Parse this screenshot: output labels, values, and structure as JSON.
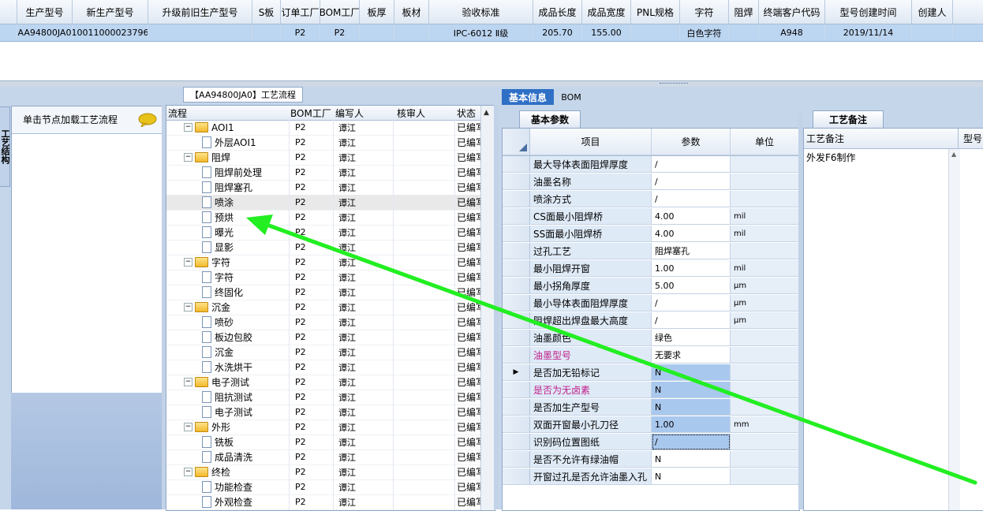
{
  "top_grid": {
    "columns": [
      "生产型号",
      "新生产型号",
      "升级前旧生产型号",
      "S板",
      "订单工厂",
      "BOM工厂",
      "板厚",
      "板材",
      "验收标准",
      "成品长度",
      "成品宽度",
      "PNL规格",
      "字符",
      "阻焊",
      "终端客户代码",
      "型号创建时间",
      "创建人"
    ],
    "row": [
      "AA94800JA0",
      "10011000023796",
      "",
      "",
      "P2",
      "P2",
      "",
      "",
      "IPC-6012 Ⅱ级",
      "205.70",
      "155.00",
      "",
      "白色字符",
      "",
      "A948",
      "2019/11/14",
      ""
    ]
  },
  "left_panel": {
    "side_tab": "工艺结构",
    "node_hint": "单击节点加载工艺流程",
    "tree_title": "【AA94800JA0】工艺流程",
    "tree_columns": [
      "流程",
      "BOM工厂",
      "编写人",
      "核审人",
      "状态"
    ],
    "tree_rows": [
      {
        "name": "AOI1",
        "type": "folder",
        "level": 0,
        "bom": "P2",
        "author": "谭江",
        "reviewer": "",
        "status": "已编写"
      },
      {
        "name": "外层AOI1",
        "type": "doc",
        "level": 1,
        "bom": "P2",
        "author": "谭江",
        "reviewer": "",
        "status": "已编写"
      },
      {
        "name": "阻焊",
        "type": "folder",
        "level": 0,
        "bom": "P2",
        "author": "谭江",
        "reviewer": "",
        "status": "已编写"
      },
      {
        "name": "阻焊前处理",
        "type": "doc",
        "level": 1,
        "bom": "P2",
        "author": "谭江",
        "reviewer": "",
        "status": "已编写"
      },
      {
        "name": "阻焊塞孔",
        "type": "doc",
        "level": 1,
        "bom": "P2",
        "author": "谭江",
        "reviewer": "",
        "status": "已编写"
      },
      {
        "name": "喷涂",
        "type": "doc",
        "level": 1,
        "bom": "P2",
        "author": "谭江",
        "reviewer": "",
        "status": "已编写",
        "selected": true
      },
      {
        "name": "预烘",
        "type": "doc",
        "level": 1,
        "bom": "P2",
        "author": "谭江",
        "reviewer": "",
        "status": "已编写"
      },
      {
        "name": "曝光",
        "type": "doc",
        "level": 1,
        "bom": "P2",
        "author": "谭江",
        "reviewer": "",
        "status": "已编写"
      },
      {
        "name": "显影",
        "type": "doc",
        "level": 1,
        "bom": "P2",
        "author": "谭江",
        "reviewer": "",
        "status": "已编写"
      },
      {
        "name": "字符",
        "type": "folder",
        "level": 0,
        "bom": "P2",
        "author": "谭江",
        "reviewer": "",
        "status": "已编写"
      },
      {
        "name": "字符",
        "type": "doc",
        "level": 1,
        "bom": "P2",
        "author": "谭江",
        "reviewer": "",
        "status": "已编写"
      },
      {
        "name": "终固化",
        "type": "doc",
        "level": 1,
        "bom": "P2",
        "author": "谭江",
        "reviewer": "",
        "status": "已编写"
      },
      {
        "name": "沉金",
        "type": "folder",
        "level": 0,
        "bom": "P2",
        "author": "谭江",
        "reviewer": "",
        "status": "已编写"
      },
      {
        "name": "喷砂",
        "type": "doc",
        "level": 1,
        "bom": "P2",
        "author": "谭江",
        "reviewer": "",
        "status": "已编写"
      },
      {
        "name": "板边包胶",
        "type": "doc",
        "level": 1,
        "bom": "P2",
        "author": "谭江",
        "reviewer": "",
        "status": "已编写"
      },
      {
        "name": "沉金",
        "type": "doc",
        "level": 1,
        "bom": "P2",
        "author": "谭江",
        "reviewer": "",
        "status": "已编写"
      },
      {
        "name": "水洗烘干",
        "type": "doc",
        "level": 1,
        "bom": "P2",
        "author": "谭江",
        "reviewer": "",
        "status": "已编写"
      },
      {
        "name": "电子测试",
        "type": "folder",
        "level": 0,
        "bom": "P2",
        "author": "谭江",
        "reviewer": "",
        "status": "已编写"
      },
      {
        "name": "阻抗测试",
        "type": "doc",
        "level": 1,
        "bom": "P2",
        "author": "谭江",
        "reviewer": "",
        "status": "已编写"
      },
      {
        "name": "电子测试",
        "type": "doc",
        "level": 1,
        "bom": "P2",
        "author": "谭江",
        "reviewer": "",
        "status": "已编写"
      },
      {
        "name": "外形",
        "type": "folder",
        "level": 0,
        "bom": "P2",
        "author": "谭江",
        "reviewer": "",
        "status": "已编写"
      },
      {
        "name": "铣板",
        "type": "doc",
        "level": 1,
        "bom": "P2",
        "author": "谭江",
        "reviewer": "",
        "status": "已编写"
      },
      {
        "name": "成品清洗",
        "type": "doc",
        "level": 1,
        "bom": "P2",
        "author": "谭江",
        "reviewer": "",
        "status": "已编写"
      },
      {
        "name": "终检",
        "type": "folder",
        "level": 0,
        "bom": "P2",
        "author": "谭江",
        "reviewer": "",
        "status": "已编写"
      },
      {
        "name": "功能检查",
        "type": "doc",
        "level": 1,
        "bom": "P2",
        "author": "谭江",
        "reviewer": "",
        "status": "已编写"
      },
      {
        "name": "外观检查",
        "type": "doc",
        "level": 1,
        "bom": "P2",
        "author": "谭江",
        "reviewer": "",
        "status": "已编写"
      }
    ]
  },
  "right_panel": {
    "tabs": [
      "基本信息",
      "BOM"
    ],
    "params_tab": "基本参数",
    "param_columns": [
      "项目",
      "参数",
      "单位"
    ],
    "params": [
      {
        "item": "最大导体表面阻焊厚度",
        "value": "/",
        "unit": ""
      },
      {
        "item": "油墨名称",
        "value": "/",
        "unit": ""
      },
      {
        "item": "喷涂方式",
        "value": "/",
        "unit": ""
      },
      {
        "item": "CS面最小阻焊桥",
        "value": "4.00",
        "unit": "mil"
      },
      {
        "item": "SS面最小阻焊桥",
        "value": "4.00",
        "unit": "mil"
      },
      {
        "item": "过孔工艺",
        "value": "阻焊塞孔",
        "unit": ""
      },
      {
        "item": "最小阻焊开窗",
        "value": "1.00",
        "unit": "mil"
      },
      {
        "item": "最小拐角厚度",
        "value": "5.00",
        "unit": "μm"
      },
      {
        "item": "最小导体表面阻焊厚度",
        "value": "/",
        "unit": "μm"
      },
      {
        "item": "阻焊超出焊盘最大高度",
        "value": "/",
        "unit": "μm"
      },
      {
        "item": "油墨颜色",
        "value": "绿色",
        "unit": ""
      },
      {
        "item": "油墨型号",
        "value": "无要求",
        "unit": "",
        "pink": true
      },
      {
        "item": "是否加无铅标记",
        "value": "N",
        "unit": "",
        "hl": true,
        "current": true
      },
      {
        "item": "是否为无卤素",
        "value": "N",
        "unit": "",
        "hl": true,
        "pink": true
      },
      {
        "item": "是否加生产型号",
        "value": "N",
        "unit": "",
        "hl": true
      },
      {
        "item": "双面开窗最小孔刀径",
        "value": "1.00",
        "unit": "mm",
        "hl": true
      },
      {
        "item": "识别码位置图纸",
        "value": "/",
        "unit": "",
        "hl2": true
      },
      {
        "item": "是否不允许有绿油帽",
        "value": "N",
        "unit": ""
      },
      {
        "item": "开窗过孔是否允许油墨入孔",
        "value": "N",
        "unit": ""
      }
    ],
    "remark_tab": "工艺备注",
    "remark_columns": [
      "工艺备注",
      "型号"
    ],
    "remark_text": "外发F6制作"
  },
  "colors": {
    "accent": "#2f6fc6",
    "selected_row": "#bcd5f0",
    "arrow": "#22ee22",
    "highlight_cell": "#a9c8ee"
  }
}
